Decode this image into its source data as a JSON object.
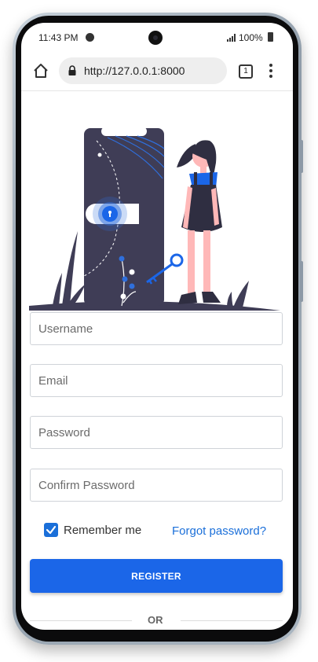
{
  "status_bar": {
    "time": "11:43 PM",
    "battery": "100%"
  },
  "browser": {
    "url": "http://127.0.0.1:8000",
    "tab_count": "1"
  },
  "form": {
    "username_placeholder": "Username",
    "email_placeholder": "Email",
    "password_placeholder": "Password",
    "confirm_password_placeholder": "Confirm Password",
    "remember_label": "Remember me",
    "remember_checked": true,
    "forgot_password_link": "Forgot password?",
    "register_button": "REGISTER",
    "divider_text": "OR"
  },
  "colors": {
    "accent": "#1b66e8",
    "link": "#1a6fd9",
    "illustration_dark": "#3f3d56",
    "illustration_skin": "#ffb8b8"
  },
  "icons": {
    "status": [
      "spotify-icon",
      "signal-icon",
      "battery-icon"
    ],
    "browser": [
      "home-icon",
      "lock-icon",
      "tabs-icon",
      "more-vert-icon"
    ]
  }
}
